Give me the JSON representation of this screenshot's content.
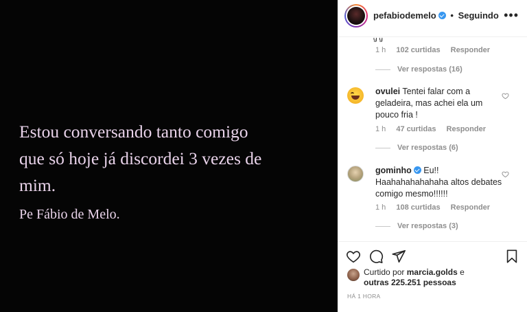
{
  "post": {
    "quote_line1": "Estou conversando tanto comigo",
    "quote_line2": "que só hoje já discordei 3 vezes de",
    "quote_line3": "mim.",
    "author": "Pe Fábio de Melo."
  },
  "header": {
    "username": "pefabiodemelo",
    "separator": "•",
    "follow_status": "Seguindo",
    "more_icon": "ellipsis-icon"
  },
  "comments": [
    {
      "user": "",
      "text": "",
      "time": "1 h",
      "likes": "102 curtidas",
      "reply": "Responder",
      "view_replies": "Ver respostas (16)"
    },
    {
      "user": "ovulei",
      "text": "Tentei falar com a geladeira, mas achei ela um pouco fria !",
      "time": "1 h",
      "likes": "47 curtidas",
      "reply": "Responder",
      "view_replies": "Ver respostas (6)"
    },
    {
      "user": "gominho",
      "text": "Eu!! Haahahahahahaha altos debates comigo mesmo!!!!!!",
      "time": "1 h",
      "likes": "108 curtidas",
      "reply": "Responder",
      "view_replies": "Ver respostas (3)"
    }
  ],
  "actions": {
    "liked_prefix": "Curtido por",
    "liked_user": "marcia.golds",
    "liked_and": "e",
    "liked_others": "outras 225.251 pessoas",
    "timestamp": "HÁ 1 HORA"
  },
  "colors": {
    "image_bg": "#050505",
    "quote_text": "#e9d3ea",
    "verified": "#3897f0",
    "muted": "#8e8e8e"
  }
}
